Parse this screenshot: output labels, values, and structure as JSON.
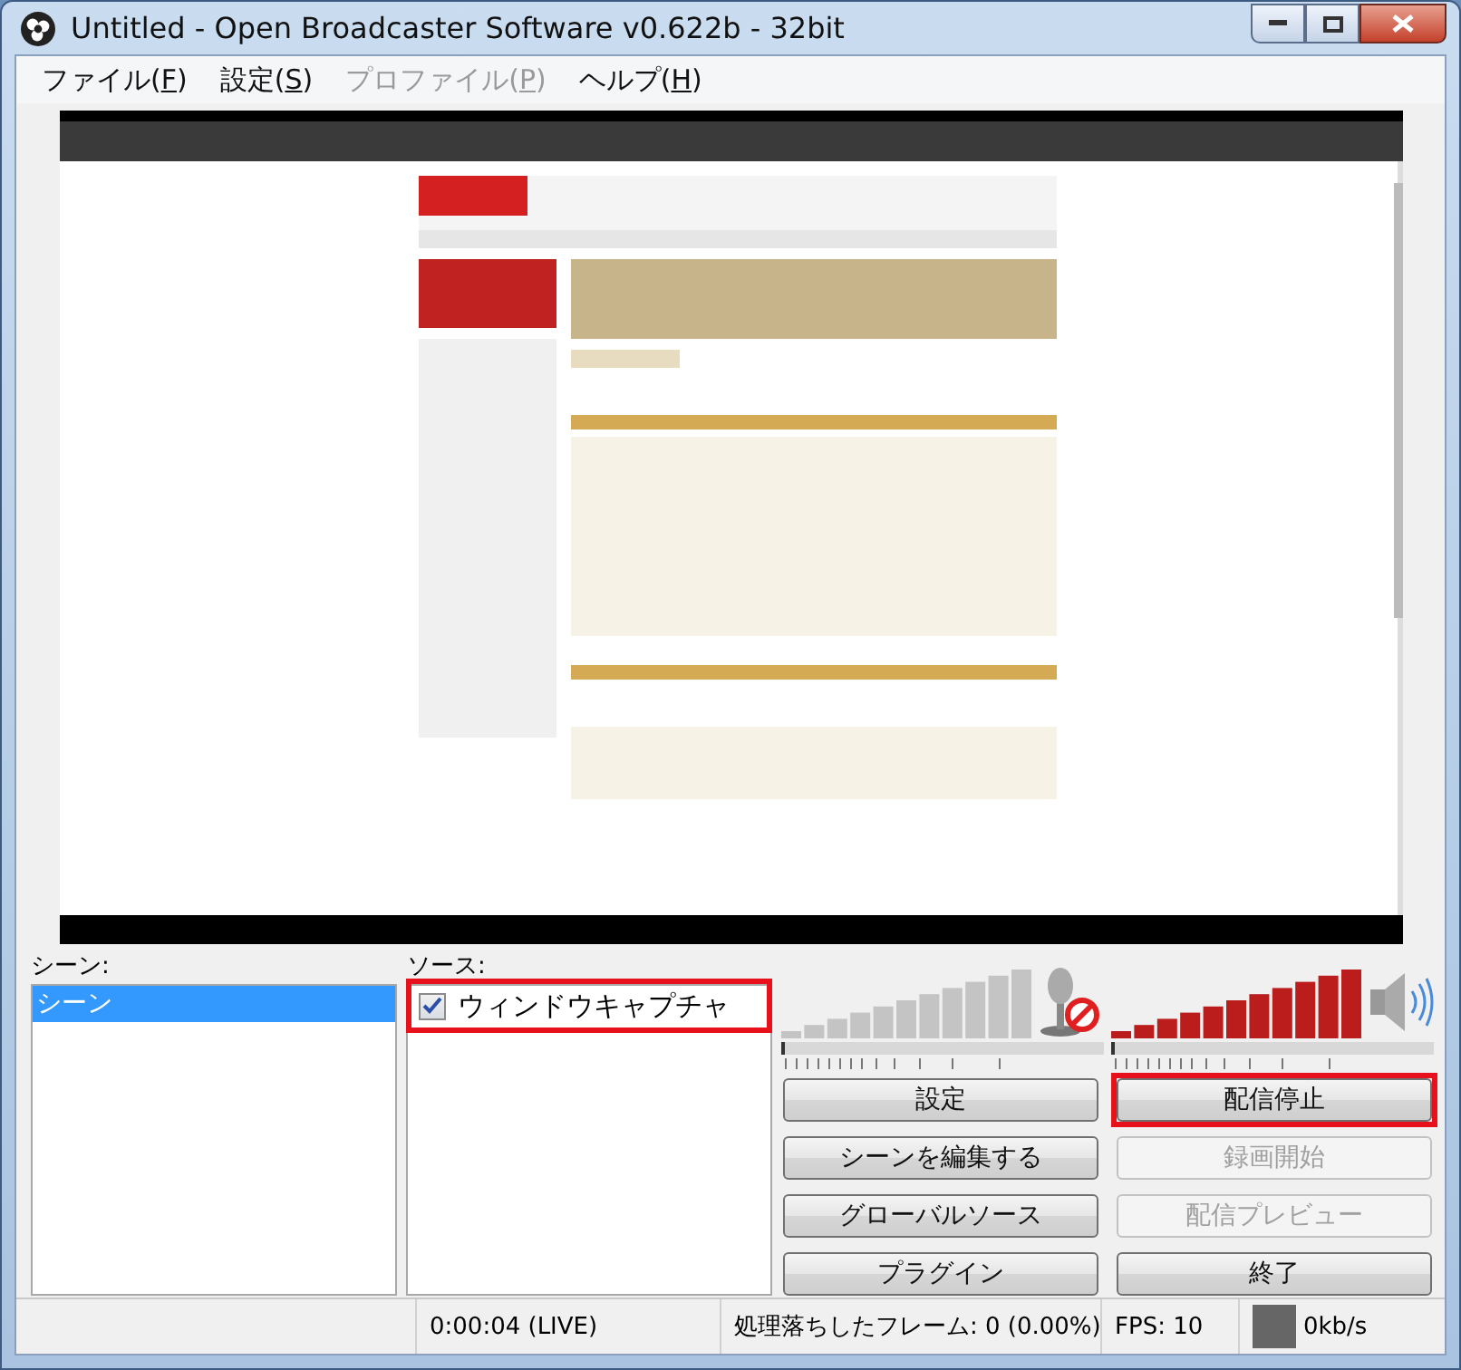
{
  "window": {
    "title": "Untitled - Open Broadcaster Software v0.622b - 32bit"
  },
  "menu": [
    {
      "label": "ファイル(F)",
      "disabled": false
    },
    {
      "label": "設定(S)",
      "disabled": false
    },
    {
      "label": "プロファイル(P)",
      "disabled": true
    },
    {
      "label": "ヘルプ(H)",
      "disabled": false
    }
  ],
  "scenes": {
    "label": "シーン:",
    "items": [
      {
        "label": "シーン",
        "selected": true
      }
    ]
  },
  "sources": {
    "label": "ソース:",
    "items": [
      {
        "label": "ウィンドウキャプチャ",
        "checked": true,
        "selected": false,
        "highlighted": true
      }
    ]
  },
  "audio": [
    {
      "kind": "mic",
      "muted": true
    },
    {
      "kind": "desktop",
      "muted": false
    }
  ],
  "buttons": [
    {
      "label": "設定",
      "disabled": false,
      "highlighted": false
    },
    {
      "label": "配信停止",
      "disabled": false,
      "highlighted": true
    },
    {
      "label": "シーンを編集する",
      "disabled": false,
      "highlighted": false
    },
    {
      "label": "録画開始",
      "disabled": true,
      "highlighted": false
    },
    {
      "label": "グローバルソース",
      "disabled": false,
      "highlighted": false
    },
    {
      "label": "配信プレビュー",
      "disabled": true,
      "highlighted": false
    },
    {
      "label": "プラグイン",
      "disabled": false,
      "highlighted": false
    },
    {
      "label": "終了",
      "disabled": false,
      "highlighted": false
    }
  ],
  "status_bar": {
    "time": "0:00:04 (LIVE)",
    "dropped_frames": "処理落ちしたフレーム: 0 (0.00%)",
    "fps": "FPS: 10",
    "bitrate": "0kb/s"
  }
}
